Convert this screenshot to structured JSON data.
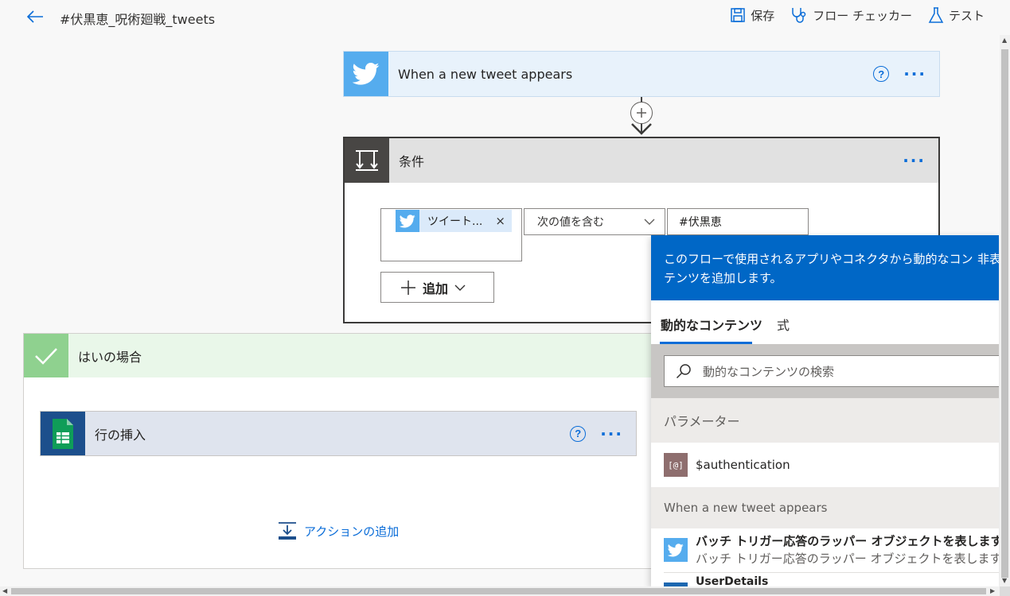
{
  "header": {
    "title": "#伏黒恵_呪術廻戦_tweets",
    "actions": [
      {
        "label": "保存",
        "icon": "save-icon"
      },
      {
        "label": "フロー チェッカー",
        "icon": "stethoscope-icon"
      },
      {
        "label": "テスト",
        "icon": "flask-icon"
      }
    ]
  },
  "trigger": {
    "title": "When a new tweet appears",
    "icon": "twitter-icon"
  },
  "condition": {
    "title": "条件",
    "token_label": "ツイート...",
    "operator": "次の値を含む",
    "value": "#伏黒恵",
    "add_label": "追加"
  },
  "yes_branch": {
    "title": "はいの場合",
    "action_title": "行の挿入",
    "add_action_label": "アクションの追加"
  },
  "dynamic_panel": {
    "description": "このフローで使用されるアプリやコネクタから動的なコンテンツを追加します。",
    "hide_label": "非表",
    "tabs": [
      "動的なコンテンツ",
      "式"
    ],
    "search_placeholder": "動的なコンテンツの検索",
    "sections": [
      {
        "title": "パラメーター",
        "items": [
          {
            "icon_text": "[@]",
            "title": "$authentication"
          }
        ]
      },
      {
        "title": "When a new tweet appears",
        "items": [
          {
            "title": "バッチ トリガー応答のラッパー オブジェクトを表します",
            "subtitle": "バッチ トリガー応答のラッパー オブジェクトを表します"
          },
          {
            "title": "UserDetails"
          }
        ]
      }
    ]
  },
  "colors": {
    "accent": "#0b6dd8",
    "panel_header": "#0067c6",
    "twitter": "#55acee",
    "condition_icon": "#484644",
    "yes_green": "#8fd18f",
    "sheets_icon": "#1c4f8c"
  }
}
